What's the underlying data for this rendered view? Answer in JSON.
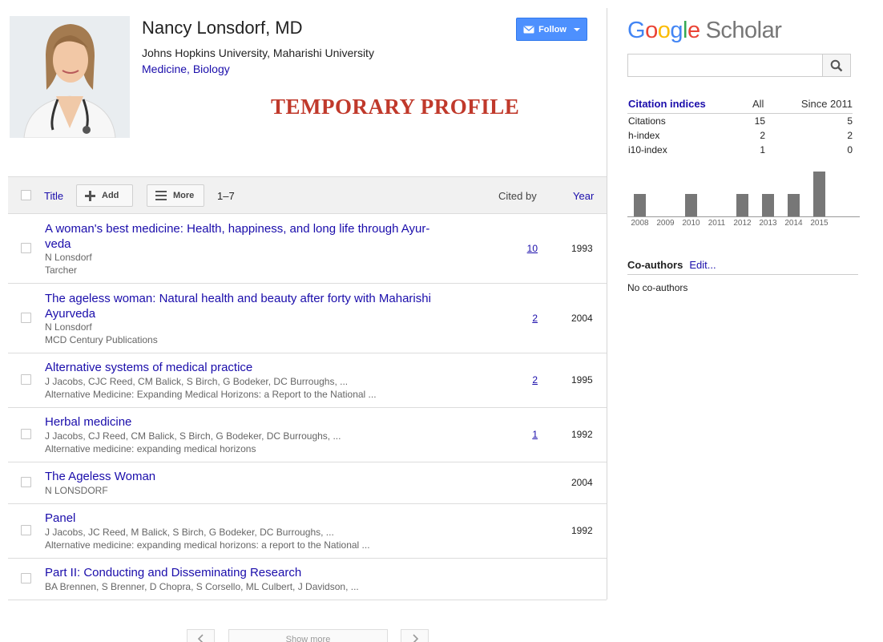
{
  "profile": {
    "name": "Nancy Lonsdorf, MD",
    "affiliation": "Johns Hopkins University, Maharishi University",
    "interests": [
      "Medicine",
      "Biology"
    ],
    "interest_separator": ", ",
    "notice": "TEMPORARY PROFILE",
    "follow_label": "Follow"
  },
  "toolbar": {
    "title_label": "Title",
    "add_label": "Add",
    "more_label": "More",
    "count": "1–7",
    "cited_by_label": "Cited by",
    "year_label": "Year"
  },
  "articles": [
    {
      "title": "A woman's best medicine: Health, happiness, and long life through Ayur-veda",
      "authors": "N Lonsdorf",
      "venue": "Tarcher",
      "cited_by": "10",
      "year": "1993"
    },
    {
      "title": "The ageless woman: Natural health and beauty after forty with Maharishi Ayurveda",
      "authors": "N Lonsdorf",
      "venue": "MCD Century Publications",
      "cited_by": "2",
      "year": "2004"
    },
    {
      "title": "Alternative systems of medical practice",
      "authors": "J Jacobs, CJC Reed, CM Balick, S Birch, G Bodeker, DC Burroughs, ...",
      "venue": "Alternative Medicine: Expanding Medical Horizons: a Report to the National ...",
      "cited_by": "2",
      "year": "1995"
    },
    {
      "title": "Herbal medicine",
      "authors": "J Jacobs, CJ Reed, CM Balick, S Birch, G Bodeker, DC Burroughs, ...",
      "venue": "Alternative medicine: expanding medical horizons",
      "cited_by": "1",
      "year": "1992"
    },
    {
      "title": "The Ageless Woman",
      "authors": "N LONSDORF",
      "venue": "",
      "cited_by": "",
      "year": "2004"
    },
    {
      "title": "Panel",
      "authors": "J Jacobs, JC Reed, M Balick, S Birch, G Bodeker, DC Burroughs, ...",
      "venue": "Alternative medicine: expanding medical horizons: a report to the National ...",
      "cited_by": "",
      "year": "1992"
    },
    {
      "title": "Part II: Conducting and Disseminating Research",
      "authors": "BA Brennen, S Brenner, D Chopra, S Corsello, ML Culbert, J Davidson, ...",
      "venue": "",
      "cited_by": "",
      "year": ""
    }
  ],
  "pager": {
    "show_more_label": "Show more"
  },
  "sidebar": {
    "logo_google": "Google",
    "logo_scholar": "Scholar",
    "citation_indices": {
      "title": "Citation indices",
      "col_all": "All",
      "col_since": "Since 2011",
      "rows": [
        {
          "label": "Citations",
          "all": "15",
          "since": "5"
        },
        {
          "label": "h-index",
          "all": "2",
          "since": "2"
        },
        {
          "label": "i10-index",
          "all": "1",
          "since": "0"
        }
      ]
    },
    "coauthors": {
      "title": "Co-authors",
      "edit_label": "Edit...",
      "empty": "No co-authors"
    }
  },
  "colors": {
    "link": "#1a0dab",
    "notice": "#c0392b",
    "follow": "#4d90fe",
    "bar": "#777777"
  },
  "chart_data": {
    "type": "bar",
    "categories": [
      "2008",
      "2009",
      "2010",
      "2011",
      "2012",
      "2013",
      "2014",
      "2015"
    ],
    "values": [
      1,
      0,
      1,
      0,
      1,
      1,
      1,
      2
    ],
    "ylim": [
      0,
      2
    ],
    "grid": false
  }
}
